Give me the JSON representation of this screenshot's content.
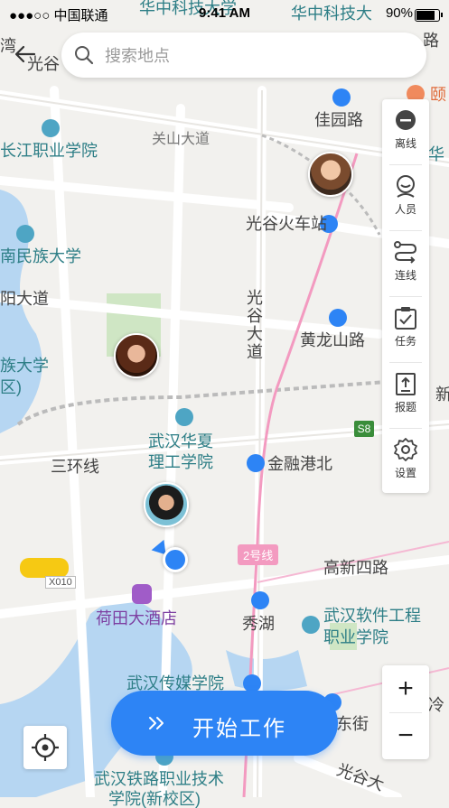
{
  "status_bar": {
    "carrier": "●●●○○ 中国联通",
    "time": "9:41 AM",
    "battery": "90%",
    "battery_level": 0.9
  },
  "search": {
    "placeholder": "搜索地点"
  },
  "toolbar": {
    "items": [
      {
        "label": "离线",
        "icon": "offline-icon"
      },
      {
        "label": "人员",
        "icon": "person-icon"
      },
      {
        "label": "连线",
        "icon": "route-icon"
      },
      {
        "label": "任务",
        "icon": "task-icon"
      },
      {
        "label": "报题",
        "icon": "report-icon"
      },
      {
        "label": "设置",
        "icon": "gear-icon"
      }
    ]
  },
  "zoom": {
    "in": "+",
    "out": "−"
  },
  "start_button": {
    "label": "开始工作"
  },
  "map_labels": {
    "l1": "华中科技大学",
    "l2": "华中科技大",
    "l3": "光谷",
    "l4": "佳园路",
    "l5": "颐",
    "l6": "关山大道",
    "l7": "长江职业学院",
    "l8": "光谷火车站",
    "l9": "南民族大学",
    "l10": "阳大道",
    "l11": "光谷大道",
    "l12": "黄龙山路",
    "l13": "族大学",
    "l14": "武汉华夏",
    "l15": "理工学院",
    "l16": "三环线",
    "l17": "金融港北",
    "l18": "2号线",
    "l19": "高新四路",
    "l20": "荷田大酒店",
    "l21": "秀湖",
    "l22": "武汉软件工程",
    "l23": "职业学院",
    "l24": "武汉传媒学院",
    "l25": "东街",
    "l26": "武汉铁路职业技术",
    "l27": "学院(新校区)",
    "l28": "光谷大",
    "l29": "S8",
    "l30": "X010",
    "l31": "湾",
    "l32": "新",
    "l33": "大学",
    "l34": "区)",
    "l35": "路",
    "l36": "路",
    "l37": "冷",
    "l38": "华"
  },
  "colors": {
    "accent": "#2d84f5",
    "map_bg": "#f2f1ee",
    "poi_teal": "#2d7e86",
    "metro_line": "#f39ac0",
    "green_area": "#cfe6c4",
    "water": "#b6d6f2"
  }
}
